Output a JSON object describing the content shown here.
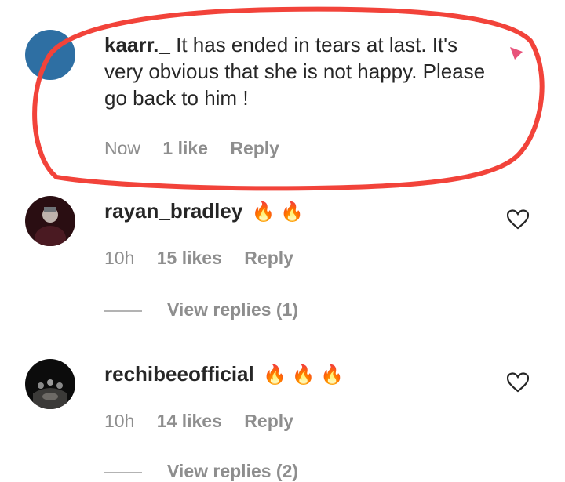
{
  "comments": [
    {
      "username": "kaarr._",
      "text": " It has ended in tears at last. It's very obvious that she is not happy. Please go back to him !",
      "time": "Now",
      "likes": "1 like",
      "reply": "Reply",
      "avatar_color": "#2e6fa3"
    },
    {
      "username": "rayan_bradley",
      "emojis": "🔥 🔥",
      "time": "10h",
      "likes": "15 likes",
      "reply": "Reply",
      "view_replies": "View replies (1)"
    },
    {
      "username": "rechibeeofficial",
      "emojis": "🔥 🔥 🔥",
      "time": "10h",
      "likes": "14 likes",
      "reply": "Reply",
      "view_replies": "View replies (2)"
    }
  ],
  "highlight_color": "#f2433a"
}
